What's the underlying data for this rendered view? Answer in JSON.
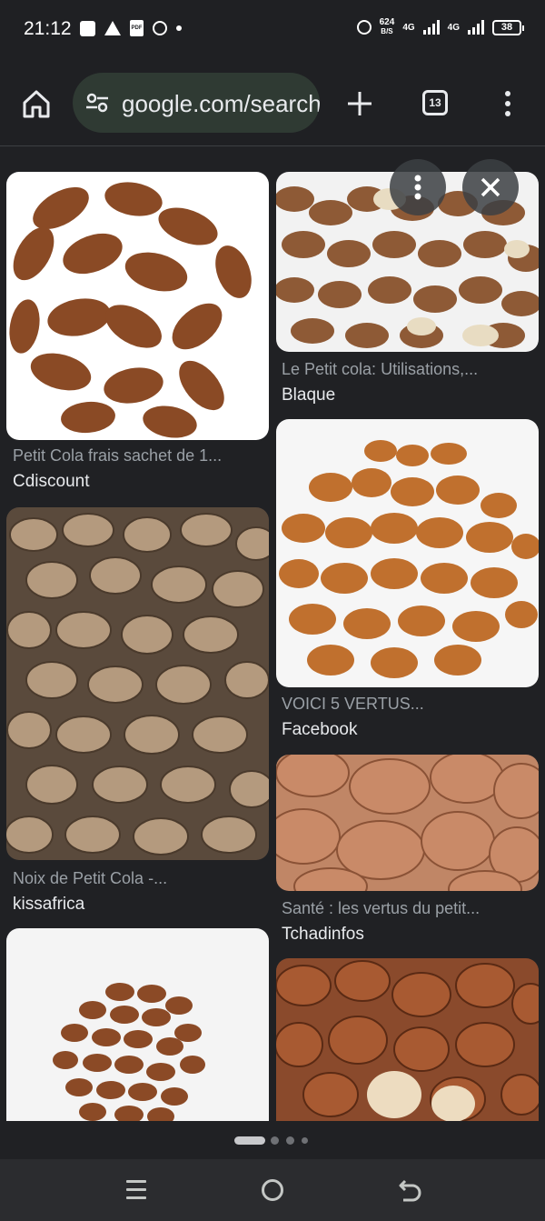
{
  "status_bar": {
    "time": "21:12",
    "net_speed_value": "624",
    "net_speed_unit": "B/S",
    "network_1": "4G",
    "network_2": "4G",
    "battery": "38",
    "icons": [
      "notification-square-icon",
      "warning-icon",
      "pdf-icon",
      "whatsapp-icon",
      "dot-icon",
      "alarm-icon",
      "signal-icon",
      "battery-icon"
    ]
  },
  "toolbar": {
    "url": "google.com/search",
    "tab_count": "13",
    "icons": [
      "home-icon",
      "site-settings-icon",
      "new-tab-plus-icon",
      "tab-switcher-icon",
      "overflow-menu-icon"
    ]
  },
  "results": [
    {
      "title": "Petit Cola frais sachet de 1...",
      "source": "Cdiscount"
    },
    {
      "title": "Le Petit cola: Utilisations,...",
      "source": "Blaque"
    },
    {
      "title": "Noix de Petit Cola -...",
      "source": "kissafrica"
    },
    {
      "title": "VOICI 5 VERTUS...",
      "source": "Facebook"
    },
    {
      "title": "Santé : les vertus du petit...",
      "source": "Tchadinfos"
    },
    {
      "title": "",
      "source": ""
    },
    {
      "title": "",
      "source": ""
    }
  ],
  "overlay": {
    "icons": [
      "more-vert-icon",
      "close-icon"
    ]
  },
  "pager": {
    "active_index": 0,
    "total": 4
  },
  "nav": {
    "icons": [
      "recents-icon",
      "home-circle-icon",
      "back-icon"
    ]
  },
  "colors": {
    "background": "#202124",
    "url_bar": "#2f3a33",
    "source_text": "#e8eaed",
    "title_text": "#9aa0a6"
  }
}
